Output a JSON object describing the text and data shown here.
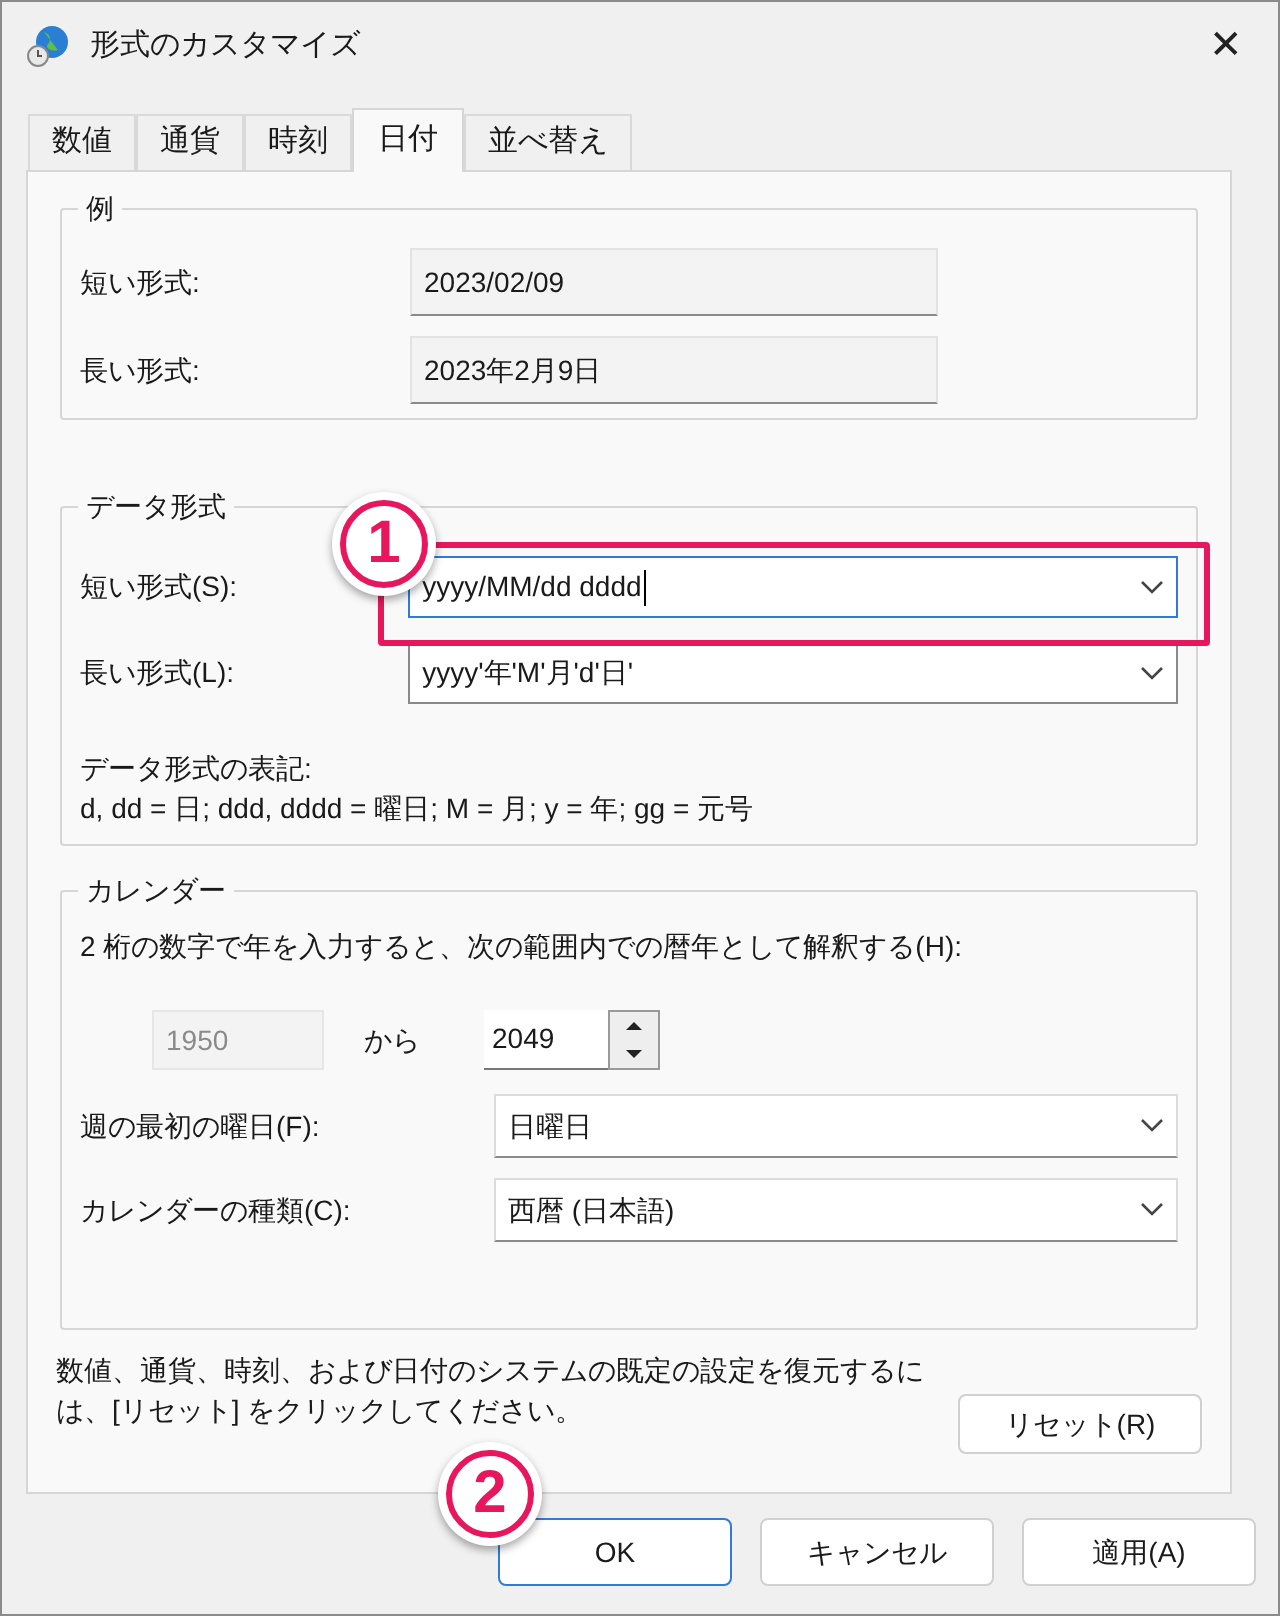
{
  "window": {
    "title": "形式のカスタマイズ",
    "close": "✕"
  },
  "tabs": [
    {
      "label": "数値",
      "selected": false
    },
    {
      "label": "通貨",
      "selected": false
    },
    {
      "label": "時刻",
      "selected": false
    },
    {
      "label": "日付",
      "selected": true
    },
    {
      "label": "並べ替え",
      "selected": false
    }
  ],
  "example": {
    "title": "例",
    "rows": [
      {
        "label": "短い形式:",
        "value": "2023/02/09"
      },
      {
        "label": "長い形式:",
        "value": "2023年2月9日"
      }
    ]
  },
  "data_format": {
    "title": "データ形式",
    "rows": [
      {
        "label": "短い形式(S):",
        "value": "yyyy/MM/dd dddd",
        "focused": true
      },
      {
        "label": "長い形式(L):",
        "value": "yyyy'年'M'月'd'日'",
        "focused": false
      }
    ],
    "notation_title": "データ形式の表記:",
    "notation": "d, dd = 日;  ddd, dddd = 曜日; M = 月; y = 年; gg = 元号"
  },
  "calendar": {
    "title": "カレンダー",
    "description": "2 桁の数字で年を入力すると、次の範囲内での暦年として解釈する(H):",
    "from_year": {
      "value": "1950",
      "disabled": true
    },
    "from_label": "から",
    "to_year": {
      "value": "2049"
    },
    "rows": [
      {
        "label": "週の最初の曜日(F):",
        "value": "日曜日"
      },
      {
        "label": "カレンダーの種類(C):",
        "value": "西暦 (日本語)"
      }
    ]
  },
  "reset_note": "数値、通貨、時刻、および日付のシステムの既定の設定を復元するには、[リセット] をクリックしてください。",
  "reset_button": "リセット(R)",
  "buttons": [
    {
      "label": "OK",
      "default": true
    },
    {
      "label": "キャンセル",
      "default": false
    },
    {
      "label": "適用(A)",
      "default": false
    }
  ],
  "annotations": [
    {
      "label": "1"
    },
    {
      "label": "2"
    }
  ]
}
